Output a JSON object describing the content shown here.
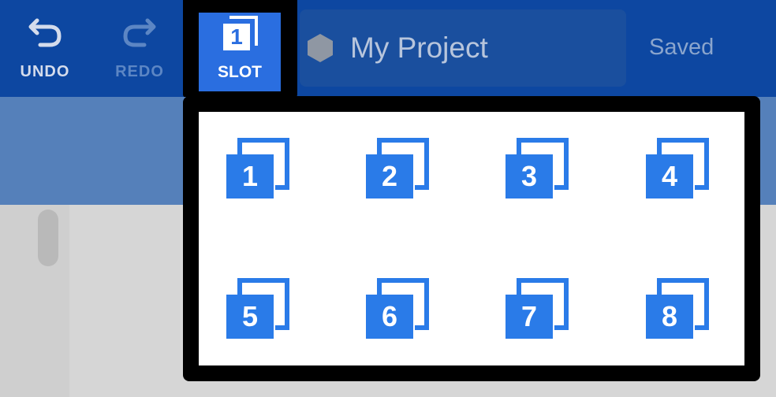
{
  "toolbar": {
    "undo_label": "UNDO",
    "redo_label": "REDO",
    "slot_label": "SLOT",
    "current_slot": "1",
    "project_name": "My Project",
    "status": "Saved"
  },
  "slots": [
    {
      "number": "1"
    },
    {
      "number": "2"
    },
    {
      "number": "3"
    },
    {
      "number": "4"
    },
    {
      "number": "5"
    },
    {
      "number": "6"
    },
    {
      "number": "7"
    },
    {
      "number": "8"
    }
  ],
  "colors": {
    "toolbar_bg": "#0d47a1",
    "slot_blue": "#2a7be8",
    "active_slot": "#2a6ee0"
  },
  "icons": [
    "undo-icon",
    "redo-icon",
    "slot-icon",
    "hexagon-icon"
  ]
}
